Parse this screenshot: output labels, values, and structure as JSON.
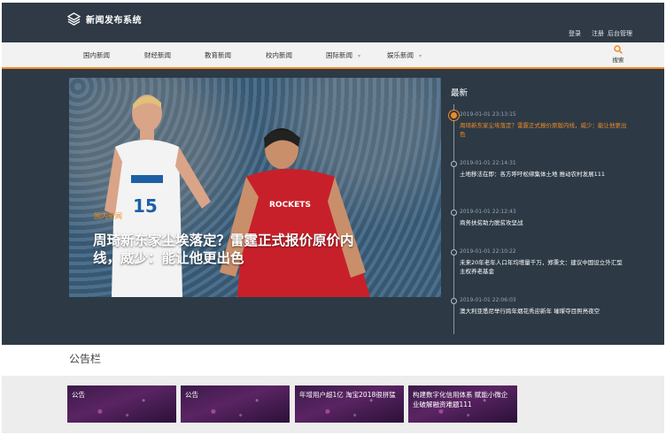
{
  "header": {
    "site_title": "新闻发布系统",
    "links": [
      "登录",
      "注册",
      "后台管理"
    ]
  },
  "nav": {
    "items": [
      {
        "label": "国内新闻",
        "has_dropdown": false
      },
      {
        "label": "财经新闻",
        "has_dropdown": false
      },
      {
        "label": "教育新闻",
        "has_dropdown": false
      },
      {
        "label": "校内新闻",
        "has_dropdown": false
      },
      {
        "label": "国际新闻",
        "has_dropdown": true
      },
      {
        "label": "娱乐新闻",
        "has_dropdown": true
      }
    ],
    "dropdown_icon": "chevron-down-icon",
    "search_label": "搜索",
    "search_icon": "search-icon"
  },
  "hero": {
    "tag": "国内新闻",
    "title": "周琦新东家尘埃落定？雷霆正式报价原价内线，威少：能让他更出色",
    "image_subject": "basketball-players-photo"
  },
  "latest": {
    "heading": "最新",
    "items": [
      {
        "time": "2019-01-01 23:13:15",
        "text": "周琦新东家尘埃落定？雷霆正式报价原版内线，威少：能让他更出色",
        "active": true
      },
      {
        "time": "2019-01-01 22:14:31",
        "text": "土地移法在即：各方呼吁松绑集体土地 推动农村发展111",
        "active": false
      },
      {
        "time": "2019-01-01 22:12:43",
        "text": "商务扶贫助力脱贫攻坚战",
        "active": false
      },
      {
        "time": "2019-01-01 22:10:22",
        "text": "未来20年老年人口年均增量千万，郑秉文：建议中国设立外汇型主权养老基金",
        "active": false
      },
      {
        "time": "2019-01-01 22:06:03",
        "text": "澳大利亚悉尼举行跨年烟花秀迎新年 璀璨夺目照亮夜空",
        "active": false
      }
    ]
  },
  "bulletin": {
    "heading": "公告栏",
    "cards": [
      "公告",
      "公告",
      "年增用户超1亿 淘宝2018很拼猛",
      "构建数字化信用体系 赋能小微企业破解融资难题111"
    ]
  },
  "colors": {
    "accent": "#f08a24",
    "header_bg": "#2f3a46",
    "content_bg": "#2d3a46",
    "nav_bg": "#f2f2f2"
  }
}
